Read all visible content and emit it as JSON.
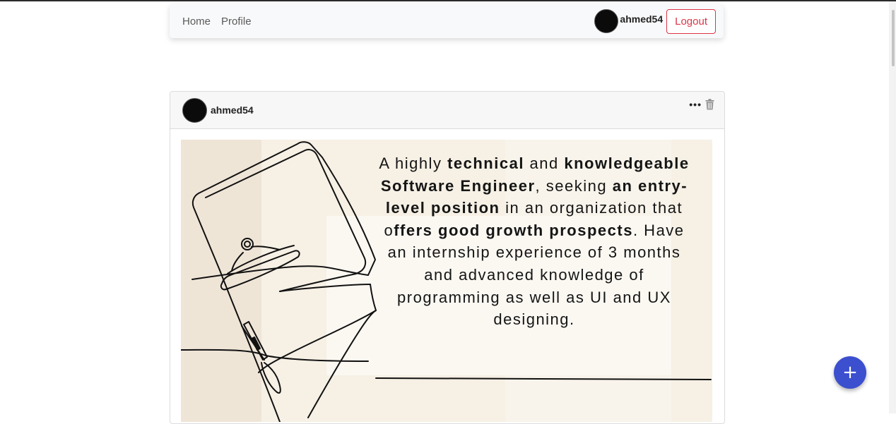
{
  "nav": {
    "links": [
      "Home",
      "Profile"
    ],
    "username": "ahmed54",
    "logout_label": "Logout"
  },
  "post": {
    "username": "ahmed54",
    "more_label": "•••",
    "image_text": {
      "l1a": "A highly ",
      "l1b": "technical",
      "l1c": " and ",
      "l1d": "knowledgeable",
      "l2a": "Software Engineer",
      "l2b": ", seeking ",
      "l2c": "an entry-",
      "l3a": "level position",
      "l3b": " in an organization that",
      "l4a": "o",
      "l4b": "ffers good growth prospects",
      "l4c": ". Have",
      "l5": "an internship experience of 3 months",
      "l6": "and advanced knowledge of",
      "l7": "programming as well as UI and UX",
      "l8": "designing."
    }
  },
  "fab": {
    "label": "+"
  },
  "colors": {
    "danger": "#dc3545",
    "fab": "#3b4fcf",
    "navbar_bg": "#f8f9fa",
    "image_bg": "#f6f0e5"
  },
  "icons": [
    "more-horizontal-icon",
    "trash-icon",
    "plus-icon"
  ]
}
